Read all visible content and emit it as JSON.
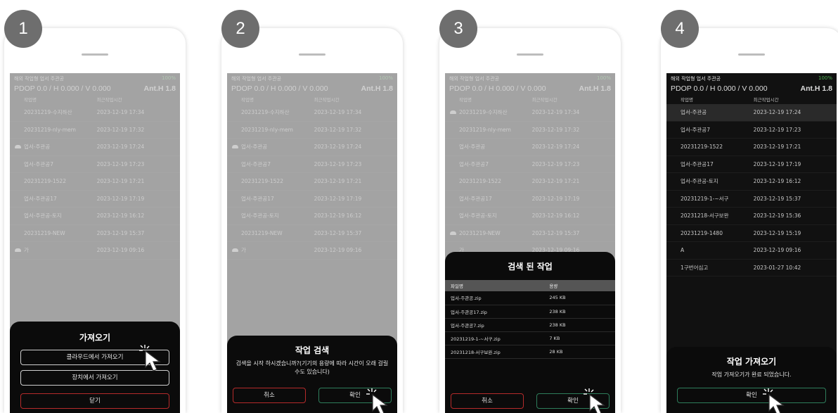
{
  "steps": [
    "1",
    "2",
    "3",
    "4"
  ],
  "status": {
    "left": "해외 작업형 업서 주관공",
    "battery": "100%"
  },
  "coords": {
    "text": "PDOP 0.0 / H 0.000 / V 0.000",
    "ant": "Ant.H 1.8"
  },
  "list_headers": {
    "name": "작업명",
    "time": "최근작업시간"
  },
  "list_a": [
    {
      "name": "20231219-수지하산",
      "time": "2023-12-19 17:34"
    },
    {
      "name": "20231219-nly-mem",
      "time": "2023-12-19 17:32"
    },
    {
      "name": "업서-주관공",
      "time": "2023-12-19 17:24"
    },
    {
      "name": "업서-주관공7",
      "time": "2023-12-19 17:23"
    },
    {
      "name": "20231219-1522",
      "time": "2023-12-19 17:21"
    },
    {
      "name": "업서-주관공17",
      "time": "2023-12-19 17:19"
    },
    {
      "name": "업서-주관공-토지",
      "time": "2023-12-19 16:12"
    },
    {
      "name": "20231219-NEW",
      "time": "2023-12-19 15:37"
    },
    {
      "name": "가",
      "time": "2023-12-19 09:16"
    }
  ],
  "list_b": [
    {
      "name": "업서-주관공",
      "time": "2023-12-19 17:24"
    },
    {
      "name": "업서-주관공7",
      "time": "2023-12-19 17:23"
    },
    {
      "name": "20231219-1522",
      "time": "2023-12-19 17:21"
    },
    {
      "name": "업서-주관공17",
      "time": "2023-12-19 17:19"
    },
    {
      "name": "업서-주관공-토지",
      "time": "2023-12-19 16:12"
    },
    {
      "name": "20231219-1-~서구",
      "time": "2023-12-19 15:37"
    },
    {
      "name": "20231218-서구보완",
      "time": "2023-12-19 15:36"
    },
    {
      "name": "20231219-1480",
      "time": "2023-12-19 15:19"
    },
    {
      "name": "A",
      "time": "2023-12-19 09:16"
    },
    {
      "name": "1구번어심고",
      "time": "2023-01-27 10:42"
    }
  ],
  "s1": {
    "title": "가져오기",
    "cloud": "클라우드에서 가져오기",
    "device": "장치에서 가져오기",
    "close": "닫기"
  },
  "s2": {
    "title": "작업 검색",
    "message": "검색을 시작 하시겠습니까?(기기의 용량에 따라 시간이 오래 걸릴 수도 있습니다)",
    "cancel": "취소",
    "ok": "확인"
  },
  "s3": {
    "title": "검색 된 작업",
    "col_file": "파일명",
    "col_size": "용량",
    "files": [
      {
        "name": "업서-주관공.zip",
        "size": "245 KB"
      },
      {
        "name": "업서-주관공17.zip",
        "size": "238 KB"
      },
      {
        "name": "업서-주관공7.zip",
        "size": "238 KB"
      },
      {
        "name": "20231219-1-~서구.zip",
        "size": "7 KB"
      },
      {
        "name": "20231218-서구보완.zip",
        "size": "28 KB"
      }
    ],
    "cancel": "취소",
    "ok": "확인"
  },
  "s4": {
    "title": "작업 가져오기",
    "message": "작업 가져오기가 완료 되었습니다.",
    "ok": "확인"
  },
  "colors": {
    "badge": "#6e6e6e",
    "red": "#b52b2b",
    "green": "#2e7d5b",
    "screen": "#111111"
  }
}
